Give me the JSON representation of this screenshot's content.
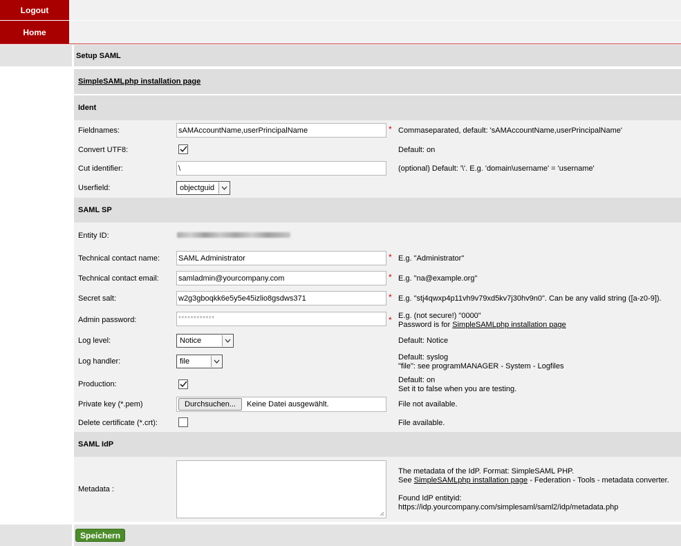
{
  "nav": {
    "logout": "Logout",
    "home": "Home"
  },
  "page": {
    "title": "Setup SAML",
    "install_link": "SimpleSAMLphp installation page"
  },
  "ident": {
    "heading": "Ident",
    "fieldnames": {
      "label": "Fieldnames:",
      "value": "sAMAccountName,userPrincipalName",
      "required": "*",
      "hint": "Commaseparated, default: 'sAMAccountName,userPrincipalName'"
    },
    "convert_utf8": {
      "label": "Convert UTF8:",
      "checked": true,
      "hint": "Default: on"
    },
    "cut_identifier": {
      "label": "Cut identifier:",
      "value": "\\",
      "hint": "(optional) Default: '\\'. E.g. 'domain\\username' = 'username'"
    },
    "userfield": {
      "label": "Userfield:",
      "value": "objectguid"
    }
  },
  "sp": {
    "heading": "SAML SP",
    "entity_id": {
      "label": "Entity ID:"
    },
    "tech_name": {
      "label": "Technical contact name:",
      "value": "SAML Administrator",
      "required": "*",
      "hint": "E.g. \"Administrator\""
    },
    "tech_email": {
      "label": "Technical contact email:",
      "value": "samladmin@yourcompany.com",
      "required": "*",
      "hint": "E.g. \"na@example.org\""
    },
    "secret_salt": {
      "label": "Secret salt:",
      "value": "w2g3gboqkk6e5y5e45izlio8gsdws371",
      "required": "*",
      "hint": "E.g. \"stj4qwxp4p11vh9v79xd5kv7j30hv9n0\". Can be any valid string ([a-z0-9])."
    },
    "admin_password": {
      "label": "Admin password:",
      "value": "************",
      "required": "*",
      "hint_line1": "E.g. (not secure!) \"0000\"",
      "hint_line2_prefix": "Password is for ",
      "hint_line2_link": "SimpleSAMLphp installation page"
    },
    "log_level": {
      "label": "Log level:",
      "value": "Notice",
      "hint": "Default: Notice"
    },
    "log_handler": {
      "label": "Log handler:",
      "value": "file",
      "hint_line1": "Default: syslog",
      "hint_line2": "\"file\": see programMANAGER - System - Logfiles"
    },
    "production": {
      "label": "Production:",
      "checked": true,
      "hint_line1": "Default: on",
      "hint_line2": "Set it to false when you are testing."
    },
    "private_key": {
      "label": "Private key (*.pem)",
      "button": "Durchsuchen...",
      "file_status": "Keine Datei ausgewählt.",
      "hint": "File not available."
    },
    "delete_cert": {
      "label": "Delete certificate (*.crt):",
      "checked": false,
      "hint": "File available."
    }
  },
  "idp": {
    "heading": "SAML IdP",
    "metadata": {
      "label": "Metadata :",
      "value": "",
      "hint_line1": "The metadata of the IdP. Format: SimpleSAML PHP.",
      "hint_line2_prefix": "See ",
      "hint_line2_link": "SimpleSAMLphp installation page",
      "hint_line2_suffix": " - Federation - Tools - metadata converter.",
      "found_label": "Found IdP entityid:",
      "found_value": "https://idp.yourcompany.com/simplesaml/saml2/idp/metadata.php"
    }
  },
  "footer": {
    "save": "Speichern"
  },
  "colors": {
    "nav_red": "#a80000",
    "band_gray": "#dedede",
    "row_gray": "#f1f1f1",
    "save_green": "#4c8c2b",
    "required_red": "#cc0000"
  }
}
